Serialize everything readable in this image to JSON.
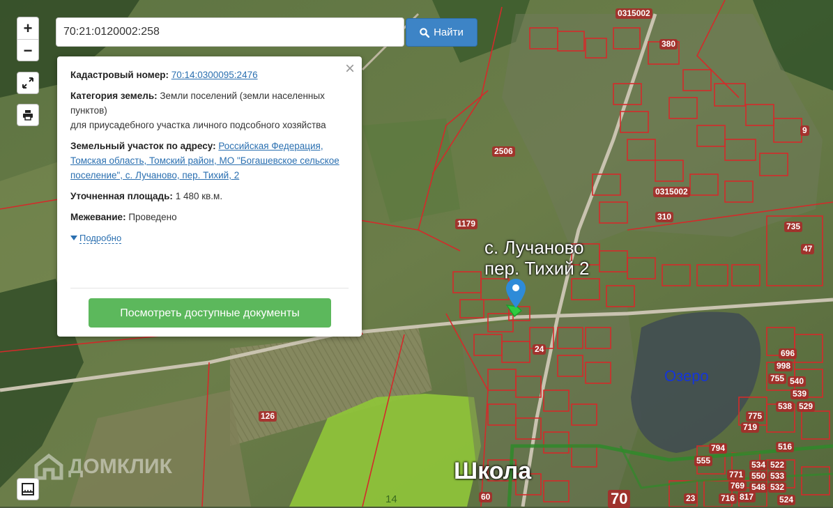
{
  "search": {
    "value": "70:21:0120002:258",
    "button_label": "Найти"
  },
  "controls": {
    "zoom_in": "+",
    "zoom_out": "−"
  },
  "popup": {
    "cadastral_label": "Кадастровый номер:",
    "cadastral_value": "70:14:0300095:2476",
    "category_label": "Категория земель:",
    "category_value": "Земли поселений (земли населенных пунктов)",
    "category_use": "для приусадебного участка личного подсобного хозяйства",
    "address_label": "Земельный участок по адресу:",
    "address_value": "Российская Федерация, Томская область, Томский район, МО \"Богашевское сельское поселение\", с. Лучаново, пер. Тихий, 2",
    "area_label": "Уточненная площадь:",
    "area_value": "1 480 кв.м.",
    "survey_label": "Межевание:",
    "survey_value": "Проведено",
    "more_label": "Подробно",
    "docs_button": "Посмотреть доступные документы",
    "close_glyph": "×"
  },
  "map": {
    "place_line1": "с. Лучаново",
    "place_line2": "пер. Тихий 2",
    "lake_label": "Озеро",
    "school_label": "Школа",
    "watermark": "ДОМКЛИК",
    "parcel_labels": [
      "0315002",
      "380",
      "2506",
      "0315002",
      "1179",
      "310",
      "735",
      "47",
      "24",
      "126",
      "696",
      "998",
      "755",
      "540",
      "539",
      "538",
      "529",
      "775",
      "719",
      "794",
      "516",
      "534",
      "522",
      "550",
      "533",
      "771",
      "769",
      "548",
      "532",
      "716",
      "817",
      "524",
      "555",
      "70",
      "14",
      "60",
      "23",
      "9"
    ],
    "colors": {
      "parcel": "#d42a2a",
      "marker": "#2e8bd8",
      "lake_text": "#1535d8",
      "field": "#8fc43a"
    }
  }
}
